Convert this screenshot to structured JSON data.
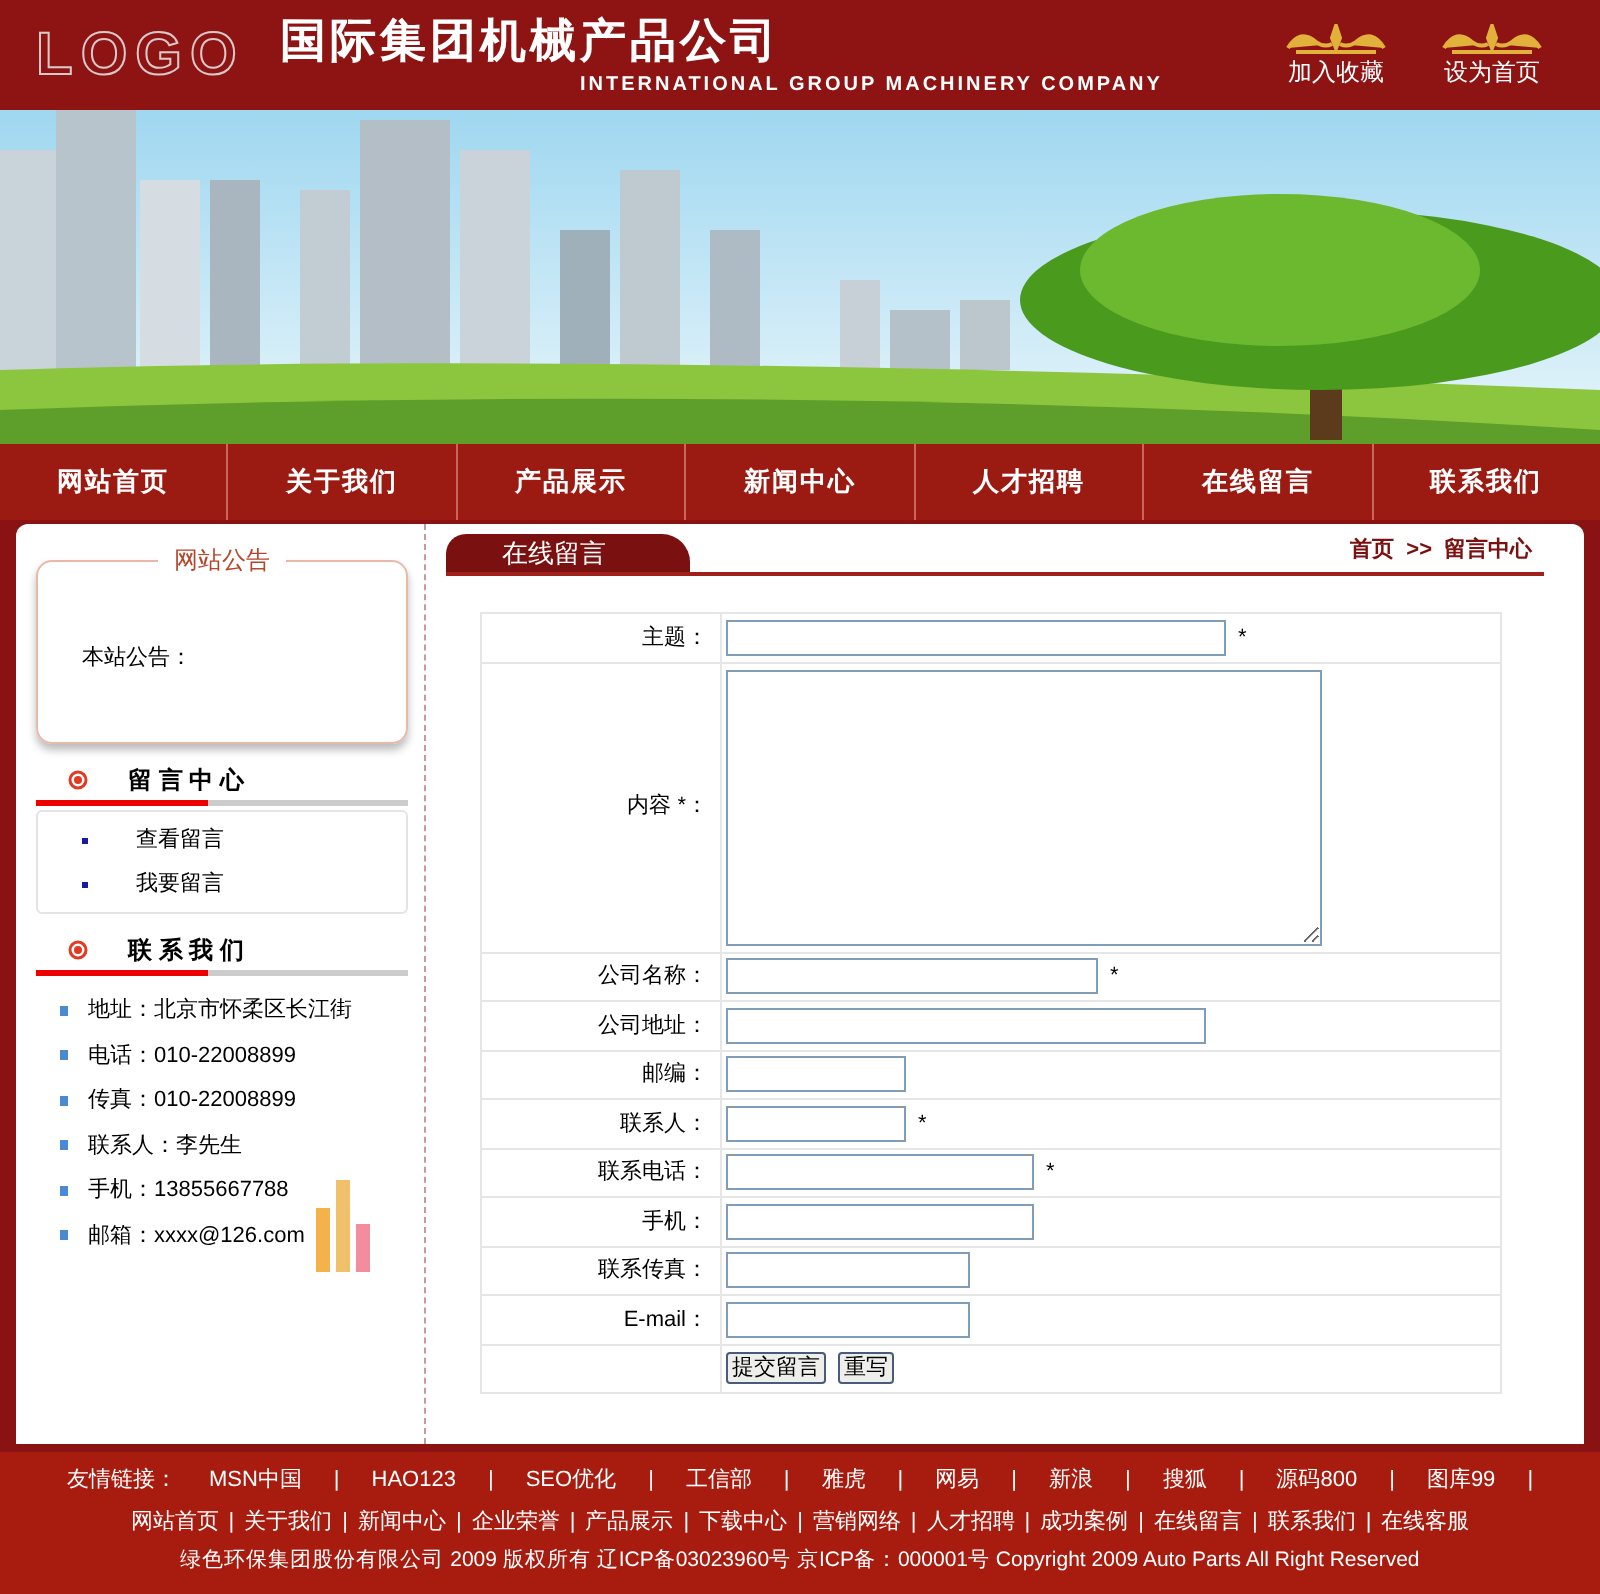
{
  "header": {
    "logo": "LOGO",
    "company_name": "国际集团机械产品公司",
    "company_name_en": "INTERNATIONAL GROUP MACHINERY COMPANY",
    "links": [
      {
        "label": "加入收藏"
      },
      {
        "label": "设为首页"
      }
    ]
  },
  "nav": [
    {
      "label": "网站首页"
    },
    {
      "label": "关于我们"
    },
    {
      "label": "产品展示"
    },
    {
      "label": "新闻中心"
    },
    {
      "label": "人才招聘"
    },
    {
      "label": "在线留言"
    },
    {
      "label": "联系我们"
    }
  ],
  "sidebar": {
    "notice": {
      "title": "网站公告",
      "text": "本站公告："
    },
    "message_center": {
      "title": "留 言 中 心",
      "items": [
        {
          "label": "查看留言"
        },
        {
          "label": "我要留言"
        }
      ]
    },
    "contact": {
      "title": "联 系 我 们",
      "items": [
        {
          "label": "地址：北京市怀柔区长江街"
        },
        {
          "label": "电话：010-22008899"
        },
        {
          "label": "传真：010-22008899"
        },
        {
          "label": "联系人：李先生"
        },
        {
          "label": "手机：13855667788"
        },
        {
          "label": "邮箱：xxxx@126.com"
        }
      ]
    }
  },
  "content": {
    "tab": "在线留言",
    "breadcrumb": [
      {
        "label": "首页"
      },
      {
        "label": ">>"
      },
      {
        "label": "留言中心"
      }
    ],
    "form": {
      "fields": [
        {
          "label": "主题：",
          "kind": "input",
          "mark": "*"
        },
        {
          "label": "内容 *：",
          "kind": "textarea"
        },
        {
          "label": "公司名称：",
          "kind": "input",
          "mark": "*"
        },
        {
          "label": "公司地址：",
          "kind": "input"
        },
        {
          "label": "邮编：",
          "kind": "input"
        },
        {
          "label": "联系人：",
          "kind": "input",
          "mark": "*"
        },
        {
          "label": "联系电话：",
          "kind": "input",
          "mark": "*"
        },
        {
          "label": "手机：",
          "kind": "input"
        },
        {
          "label": "联系传真：",
          "kind": "input"
        },
        {
          "label": "E-mail：",
          "kind": "input"
        }
      ],
      "buttons": [
        {
          "label": "提交留言"
        },
        {
          "label": "重写"
        }
      ]
    }
  },
  "footer": {
    "friend_links_label": "友情链接：",
    "separator": "|",
    "friend_links": [
      {
        "label": "MSN中国"
      },
      {
        "label": "HAO123"
      },
      {
        "label": "SEO优化"
      },
      {
        "label": "工信部"
      },
      {
        "label": "雅虎"
      },
      {
        "label": "网易"
      },
      {
        "label": "新浪"
      },
      {
        "label": "搜狐"
      },
      {
        "label": "源码800"
      },
      {
        "label": "图库99"
      }
    ],
    "site_links": [
      {
        "label": "网站首页"
      },
      {
        "label": "关于我们"
      },
      {
        "label": "新闻中心"
      },
      {
        "label": "企业荣誉"
      },
      {
        "label": "产品展示"
      },
      {
        "label": "下载中心"
      },
      {
        "label": "营销网络"
      },
      {
        "label": "人才招聘"
      },
      {
        "label": "成功案例"
      },
      {
        "label": "在线留言"
      },
      {
        "label": "联系我们"
      },
      {
        "label": "在线客服"
      }
    ],
    "copyright": "绿色环保集团股份有限公司 2009 版权所有 辽ICP备03023960号 京ICP备：000001号 Copyright 2009 Auto Parts All Right Reserved"
  }
}
